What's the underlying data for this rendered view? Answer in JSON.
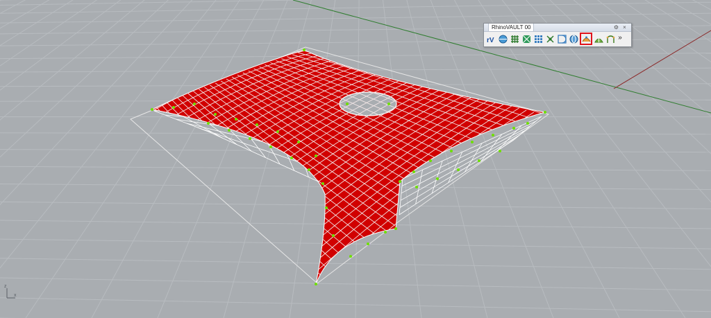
{
  "toolbar": {
    "title": "RhinoVAULT 00",
    "gear_glyph": "⚙",
    "close_glyph": "×",
    "overflow_glyph": "»",
    "buttons": [
      {
        "name": "rv-logo-icon",
        "label": "rV",
        "active": false
      },
      {
        "name": "sphere-grid-icon",
        "active": false
      },
      {
        "name": "hash-grid-icon",
        "active": false
      },
      {
        "name": "diagonal-grid-icon",
        "active": false
      },
      {
        "name": "rect-grid-icon",
        "active": false
      },
      {
        "name": "node-cross-icon",
        "active": false
      },
      {
        "name": "half-circle-icon",
        "active": false
      },
      {
        "name": "globe-icon",
        "active": false
      },
      {
        "name": "vault-relax-icon",
        "active": true
      },
      {
        "name": "vault-form-icon",
        "active": false
      },
      {
        "name": "arch-support-icon",
        "active": false
      }
    ]
  },
  "viewport": {
    "axis_labels": {
      "x": "x",
      "z": "z"
    }
  },
  "colors": {
    "background": "#a9adb1",
    "grid": "#b8bcc0",
    "surface": "#d10000",
    "mesh": "#f2e6e6",
    "nodes": "#6ee000",
    "x_axis": "#8c2a2a",
    "y_axis": "#2f7d2f",
    "active_highlight": "#e0121b"
  }
}
